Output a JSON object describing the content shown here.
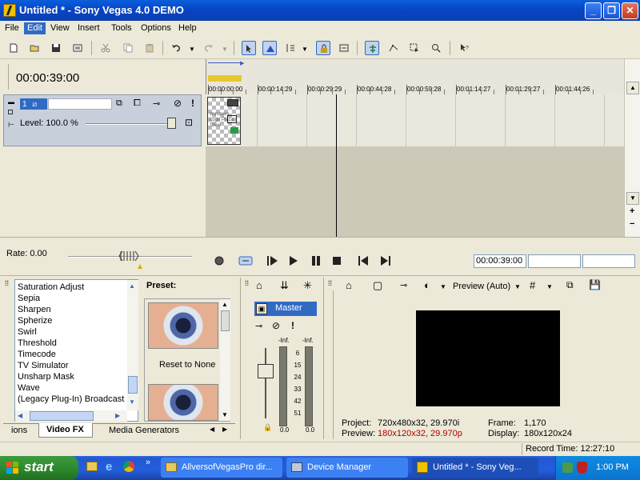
{
  "window": {
    "title": "Untitled * - Sony Vegas 4.0 DEMO",
    "minimize": "_",
    "restore": "❐",
    "close": "✕"
  },
  "menu": {
    "file": "File",
    "edit": "Edit",
    "view": "View",
    "insert": "Insert",
    "tools": "Tools",
    "options": "Options",
    "help": "Help"
  },
  "timeline": {
    "timecode": "00:00:39:00",
    "ruler_labels": [
      "00:00:00:00",
      "00:00:14:29",
      "00:00:29:29",
      "00:00:44:28",
      "00:00:59:28",
      "00:01:14:27",
      "00:01:29:27",
      "00:01:44:26"
    ],
    "track": {
      "number": "1",
      "level_label": "Level: 100.0 %",
      "event_text": "Windows Logo Plaza Towe"
    }
  },
  "transport": {
    "rate_label": "Rate: 0.00",
    "time_field": "00:00:39:00",
    "scroll_plus": "+",
    "scroll_minus": "−"
  },
  "fx_list": {
    "items": [
      "Saturation Adjust",
      "Sepia",
      "Sharpen",
      "Spherize",
      "Swirl",
      "Threshold",
      "Timecode",
      "TV Simulator",
      "Unsharp Mask",
      "Wave",
      "(Legacy Plug-In) Broadcast C"
    ],
    "preset_label": "Preset:",
    "preset_1": "Reset to None"
  },
  "tabs": {
    "left_tab": "ions",
    "active_tab": "Video FX",
    "right_tab": "Media Generators"
  },
  "mixer": {
    "master_label": "Master",
    "db_top_left": "-Inf.",
    "db_top_right": "-Inf.",
    "scale": [
      "6",
      "15",
      "24",
      "33",
      "42",
      "51"
    ],
    "bottom_left": "0.0",
    "bottom_right": "0.0"
  },
  "preview": {
    "mode": "Preview (Auto)",
    "project_label": "Project:",
    "project_value": "720x480x32, 29.970i",
    "preview_label": "Preview:",
    "preview_value": "180x120x32, 29.970p",
    "frame_label": "Frame:",
    "frame_value": "1,170",
    "display_label": "Display:",
    "display_value": "180x120x24"
  },
  "status": {
    "record_time": "Record Time: 12:27:10"
  },
  "taskbar": {
    "start": "start",
    "tasks": [
      "AllversofVegasPro dir...",
      "Device Manager",
      "Untitled * - Sony Veg..."
    ],
    "clock": "1:00 PM",
    "overflow": "»"
  },
  "colors": {
    "accent": "#316ac5",
    "track_header": "#c8d0dc",
    "preview_red": "#b00000"
  }
}
